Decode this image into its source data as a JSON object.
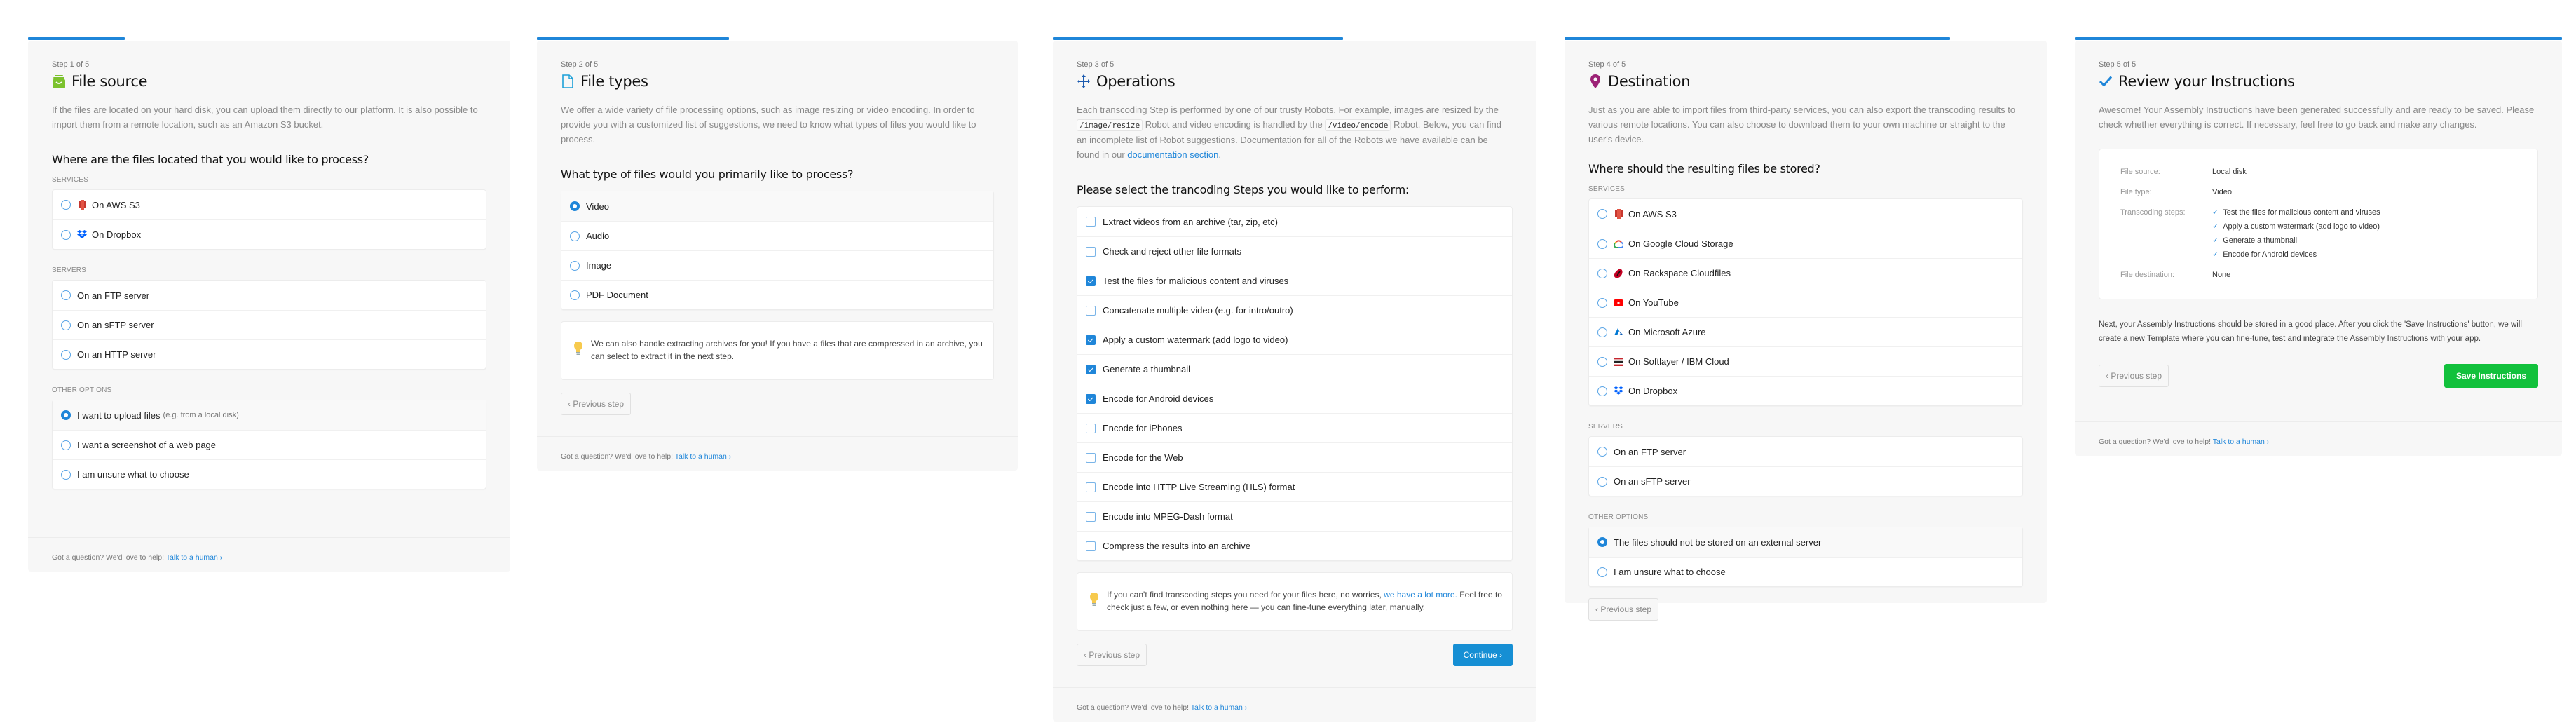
{
  "colors": {
    "accent": "#1f86d9",
    "save_green": "#12c13c",
    "panel_bg": "#f7f7f7"
  },
  "common": {
    "footer_text": "Got a question? We'd love to help!",
    "footer_link": "Talk to a human ›",
    "prev_label": "‹ Previous step"
  },
  "steps": [
    {
      "step_label": "Step 1 of 5",
      "title": "File source",
      "icon": "inbox-icon",
      "progress": 0.2,
      "intro": "If the files are located on your hard disk, you can upload them directly to our platform. It is also possible to import them from a remote location, such as an Amazon S3 bucket.",
      "question": "Where are the files located that you would like to process?",
      "groups": [
        {
          "label": "Services",
          "options": [
            {
              "label": "On AWS S3",
              "icon": "aws-s3-icon",
              "selected": false
            },
            {
              "label": "On Dropbox",
              "icon": "dropbox-icon",
              "selected": false
            }
          ]
        },
        {
          "label": "Servers",
          "options": [
            {
              "label": "On an FTP server",
              "selected": false
            },
            {
              "label": "On an sFTP server",
              "selected": false
            },
            {
              "label": "On an HTTP server",
              "selected": false
            }
          ]
        },
        {
          "label": "Other options",
          "options": [
            {
              "label": "I want to upload files",
              "hint": "(e.g. from a local disk)",
              "selected": true
            },
            {
              "label": "I want a screenshot of a web page",
              "selected": false
            },
            {
              "label": "I am unsure what to choose",
              "selected": false
            }
          ]
        }
      ]
    },
    {
      "step_label": "Step 2 of 5",
      "title": "File types",
      "icon": "file-icon",
      "progress": 0.4,
      "intro": "We offer a wide variety of file processing options, such as image resizing or video encoding. In order to provide you with a customized list of suggestions, we need to know what types of files you would like to process.",
      "question": "What type of files would you primarily like to process?",
      "options": [
        {
          "label": "Video",
          "selected": true
        },
        {
          "label": "Audio",
          "selected": false
        },
        {
          "label": "Image",
          "selected": false
        },
        {
          "label": "PDF Document",
          "selected": false
        }
      ],
      "tip": "We can also handle extracting archives for you! If you have a files that are compressed in an archive, you can select to extract it in the next step."
    },
    {
      "step_label": "Step 3 of 5",
      "title": "Operations",
      "icon": "move-arrows-icon",
      "progress": 0.6,
      "intro_parts": {
        "a": "Each transcoding Step is performed by one of our trusty Robots. For example, images are resized by the",
        "code1": "/image/resize",
        "b": "Robot and video encoding is handled by the",
        "code2": "/video/encode",
        "c": "Robot. Below, you can find an incomplete list of Robot suggestions. Documentation for all of the Robots we have available can be found in our",
        "link": "documentation section",
        "d": "."
      },
      "question": "Please select the trancoding Steps you would like to perform:",
      "checks": [
        {
          "label": "Extract videos from an archive (tar, zip, etc)",
          "checked": false
        },
        {
          "label": "Check and reject other file formats",
          "checked": false
        },
        {
          "label": "Test the files for malicious content and viruses",
          "checked": true
        },
        {
          "label": "Concatenate multiple video (e.g. for intro/outro)",
          "checked": false
        },
        {
          "label": "Apply a custom watermark (add logo to video)",
          "checked": true
        },
        {
          "label": "Generate a thumbnail",
          "checked": true
        },
        {
          "label": "Encode for Android devices",
          "checked": true
        },
        {
          "label": "Encode for iPhones",
          "checked": false
        },
        {
          "label": "Encode for the Web",
          "checked": false
        },
        {
          "label": "Encode into HTTP Live Streaming (HLS) format",
          "checked": false
        },
        {
          "label": "Encode into MPEG-Dash format",
          "checked": false
        },
        {
          "label": "Compress the results into an archive",
          "checked": false
        }
      ],
      "tip_parts": {
        "a": "If you can't find transcoding steps you need for your files here, no worries,",
        "link": "we have a lot more.",
        "b": "Feel free to check just a few, or even nothing here — you can fine-tune everything later, manually."
      },
      "continue_label": "Continue ›"
    },
    {
      "step_label": "Step 4 of 5",
      "title": "Destination",
      "icon": "map-pin-icon",
      "progress": 0.8,
      "intro": "Just as you are able to import files from third-party services, you can also export the transcoding results to various remote locations. You can also choose to download them to your own machine or straight to the user's device.",
      "question": "Where should the resulting files be stored?",
      "groups": [
        {
          "label": "Services",
          "options": [
            {
              "label": "On AWS S3",
              "icon": "aws-s3-icon",
              "selected": false
            },
            {
              "label": "On Google Cloud Storage",
              "icon": "google-cloud-icon",
              "selected": false
            },
            {
              "label": "On Rackspace Cloudfiles",
              "icon": "rackspace-icon",
              "selected": false
            },
            {
              "label": "On YouTube",
              "icon": "youtube-icon",
              "selected": false
            },
            {
              "label": "On Microsoft Azure",
              "icon": "azure-icon",
              "selected": false
            },
            {
              "label": "On Softlayer / IBM Cloud",
              "icon": "ibm-cloud-icon",
              "selected": false
            },
            {
              "label": "On Dropbox",
              "icon": "dropbox-icon",
              "selected": false
            }
          ]
        },
        {
          "label": "Servers",
          "options": [
            {
              "label": "On an FTP server",
              "selected": false
            },
            {
              "label": "On an sFTP server",
              "selected": false
            }
          ]
        },
        {
          "label": "Other options",
          "options": [
            {
              "label": "The files should not be stored on an external server",
              "selected": true
            },
            {
              "label": "I am unsure what to choose",
              "selected": false
            }
          ]
        }
      ]
    },
    {
      "step_label": "Step 5 of 5",
      "title": "Review your Instructions",
      "icon": "checkmark-icon",
      "progress": 1.0,
      "intro": "Awesome! Your Assembly Instructions have been generated successfully and are ready to be saved. Please check whether everything is correct. If necessary, feel free to go back and make any changes.",
      "summary": {
        "file_source_key": "File source:",
        "file_source_val": "Local disk",
        "file_type_key": "File type:",
        "file_type_val": "Video",
        "steps_key": "Transcoding steps:",
        "steps_vals": [
          "Test the files for malicious content and viruses",
          "Apply a custom watermark (add logo to video)",
          "Generate a thumbnail",
          "Encode for Android devices"
        ],
        "destination_key": "File destination:",
        "destination_val": "None"
      },
      "next_text": "Next, your Assembly Instructions should be stored in a good place. After you click the 'Save Instructions' button, we will create a new Template where you can fine-tune, test and integrate the Assembly Instructions with your app.",
      "save_label": "Save Instructions"
    }
  ]
}
